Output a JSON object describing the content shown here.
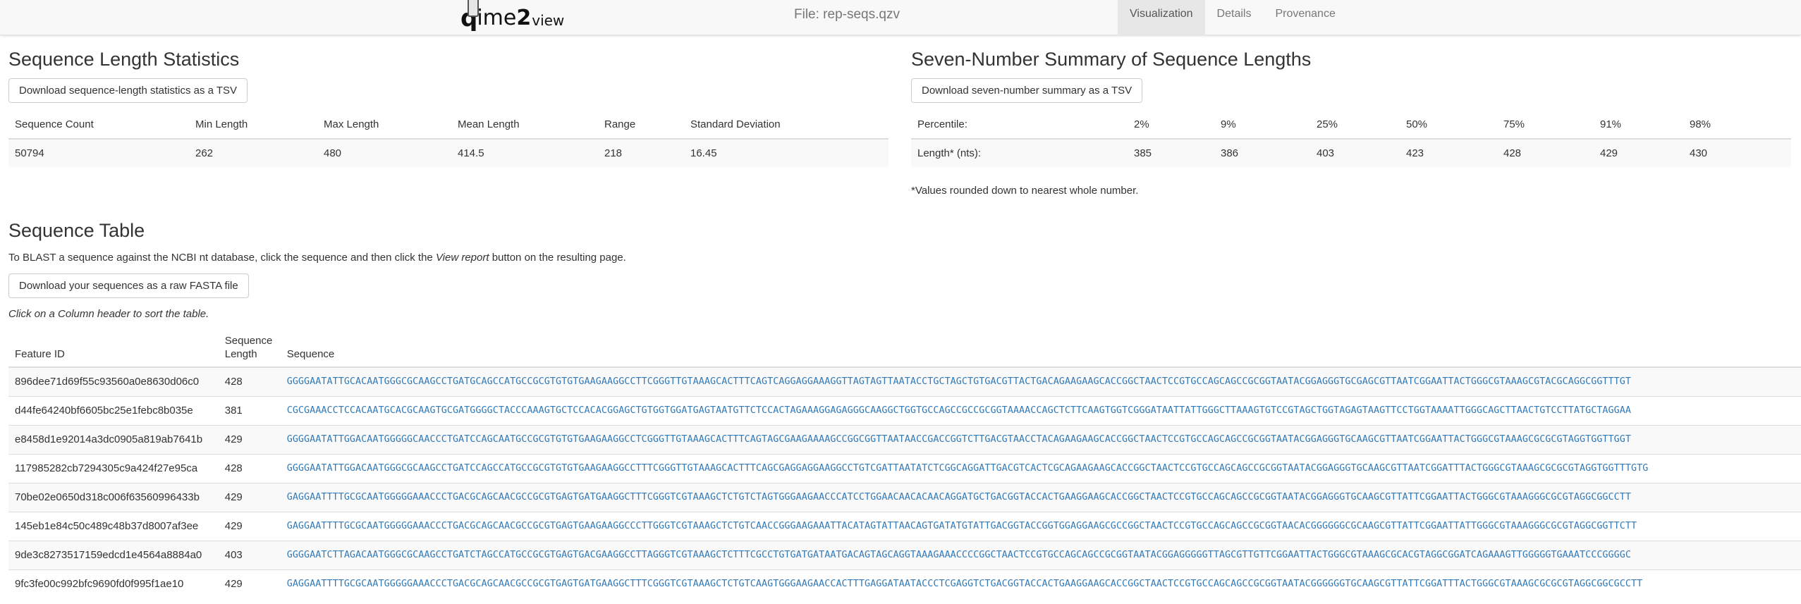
{
  "header": {
    "logo_text": "qiime2view",
    "file_title": "File: rep-seqs.qzv",
    "tabs": [
      {
        "label": "Visualization",
        "active": true
      },
      {
        "label": "Details",
        "active": false
      },
      {
        "label": "Provenance",
        "active": false
      }
    ]
  },
  "length_stats": {
    "title": "Sequence Length Statistics",
    "download_label": "Download sequence-length statistics as a TSV",
    "headers": [
      "Sequence Count",
      "Min Length",
      "Max Length",
      "Mean Length",
      "Range",
      "Standard Deviation"
    ],
    "values": [
      "50794",
      "262",
      "480",
      "414.5",
      "218",
      "16.45"
    ]
  },
  "seven_number": {
    "title": "Seven-Number Summary of Sequence Lengths",
    "download_label": "Download seven-number summary as a TSV",
    "headers": [
      "Percentile:",
      "2%",
      "9%",
      "25%",
      "50%",
      "75%",
      "91%",
      "98%"
    ],
    "values": [
      "Length* (nts):",
      "385",
      "386",
      "403",
      "423",
      "428",
      "429",
      "430"
    ],
    "footnote": "*Values rounded down to nearest whole number."
  },
  "sequence_table": {
    "title": "Sequence Table",
    "blast_note_before": "To BLAST a sequence against the NCBI nt database, click the sequence and then click the ",
    "blast_note_italic": "View report",
    "blast_note_after": " button on the resulting page.",
    "download_label": "Download your sequences as a raw FASTA file",
    "sort_hint": "Click on a Column header to sort the table.",
    "headers": {
      "feature_id": "Feature ID",
      "length_line1": "Sequence",
      "length_line2": "Length",
      "sequence": "Sequence"
    },
    "rows": [
      {
        "id": "896dee71d69f55c93560a0e8630d06c0",
        "length": "428",
        "seq": "GGGGAATATTGCACAATGGGCGCAAGCCTGATGCAGCCATGCCGCGTGTGTGAAGAAGGCCTTCGGGTTGTAAAGCACTTTCAGTCAGGAGGAAAGGTTAGTAGTTAATACCTGCTAGCTGTGACGTTACTGACAGAAGAAGCACCGGCTAACTCCGTGCCAGCAGCCGCGGTAATACGGAGGGTGCGAGCGTTAATCGGAATTACTGGGCGTAAAGCGTACGCAGGCGGTTTGT"
      },
      {
        "id": "d44fe64240bf6605bc25e1febc8b035e",
        "length": "381",
        "seq": "CGCGAAACCTCCACAATGCACGCAAGTGCGATGGGGCTACCCAAAGTGCTCCACACGGAGCTGTGGTGGATGAGTAATGTTCTCCACTAGAAAGGAGAGGGCAAGGCTGGTGCCAGCCGCCGCGGTAAAACCAGCTCTTCAAGTGGTCGGGATAATTATTGGGCTTAAAGTGTCCGTAGCTGGTAGAGTAAGTTCCTGGTAAAATTGGGCAGCTTAACTGTCCTTATGCTAGGAA"
      },
      {
        "id": "e8458d1e92014a3dc0905a819ab7641b",
        "length": "429",
        "seq": "GGGGAATATTGGACAATGGGGGCAACCCTGATCCAGCAATGCCGCGTGTGTGAAGAAGGCCTCGGGTTGTAAAGCACTTTCAGTAGCGAAGAAAAGCCGGCGGTTAATAACCGACCGGTCTTGACGTAACCTACAGAAGAAGCACCGGCTAACTCCGTGCCAGCAGCCGCGGTAATACGGAGGGTGCAAGCGTTAATCGGAATTACTGGGCGTAAAGCGCGCGTAGGTGGTTGGT"
      },
      {
        "id": "117985282cb7294305c9a424f27e95ca",
        "length": "428",
        "seq": "GGGGAATATTGGACAATGGGCGCAAGCCTGATCCAGCCATGCCGCGTGTGTGAAGAAGGCCTTTCGGGTTGTAAAGCACTTTCAGCGAGGAGGAAGGCCTGTCGATTAATATCTCGGCAGGATTGACGTCACTCGCAGAAGAAGCACCGGCTAACTCCGTGCCAGCAGCCGCGGTAATACGGAGGGTGCAAGCGTTAATCGGATTTACTGGGCGTAAAGCGCGCGTAGGTGGTTTGTG"
      },
      {
        "id": "70be02e0650d318c006f63560996433b",
        "length": "429",
        "seq": "GAGGAATTTTGCGCAATGGGGGAAACCCTGACGCAGCAACGCCGCGTGAGTGATGAAGGCTTTCGGGTCGTAAAGCTCTGTCTAGTGGGAAGAACCCATCCTGGAACAACACAACAGGATGCTGACGGTACCACTGAAGGAAGCACCGGCTAACTCCGTGCCAGCAGCCGCGGTAATACGGAGGGTGCAAGCGTTATTCGGAATTACTGGGCGTAAAGGGCGCGTAGGCGGCCTT"
      },
      {
        "id": "145eb1e84c50c489c48b37d8007af3ee",
        "length": "429",
        "seq": "GAGGAATTTTGCGCAATGGGGGAAACCCTGACGCAGCAACGCCGCGTGAGTGAAGAAGGCCCTTGGGTCGTAAAGCTCTGTCAACCGGGAAGAAATTACATAGTATTAACAGTGATATGTATTGACGGTACCGGTGGAGGAAGCGCCGGCTAACTCCGTGCCAGCAGCCGCGGTAACACGGGGGGCGCAAGCGTTATTCGGAATTATTGGGCGTAAAGGGCGCGTAGGCGGTTCTT"
      },
      {
        "id": "9de3c8273517159edcd1e4564a8884a0",
        "length": "403",
        "seq": "GGGGAATCTTAGACAATGGGCGCAAGCCTGATCTAGCCATGCCGCGTGAGTGACGAAGGCCTTAGGGTCGTAAAGCTCTTTCGCCTGTGATGATAATGACAGTAGCAGGTAAAGAAACCCCGGCTAACTCCGTGCCAGCAGCCGCGGTAATACGGAGGGGGTTAGCGTTGTTCGGAATTACTGGGCGTAAAGCGCACGTAGGCGGATCAGAAAGTTGGGGGTGAAATCCCGGGGC"
      },
      {
        "id": "9fc3fe00c992bfc9690fd0f995f1ae10",
        "length": "429",
        "seq": "GAGGAATTTTGCGCAATGGGGGAAACCCTGACGCAGCAACGCCGCGTGAGTGATGAAGGCTTTCGGGTCGTAAAGCTCTGTCAAGTGGGAAGAACCACTTTGAGGATAATACCCTCGAGGTCTGACGGTACCACTGAAGGAAGCACCGGCTAACTCCGTGCCAGCAGCCGCGGTAATACGGGGGGTGCAAGCGTTATTCGGATTTACTGGGCGTAAAGCGCGCGTAGGCGGCGCCTT"
      }
    ]
  }
}
